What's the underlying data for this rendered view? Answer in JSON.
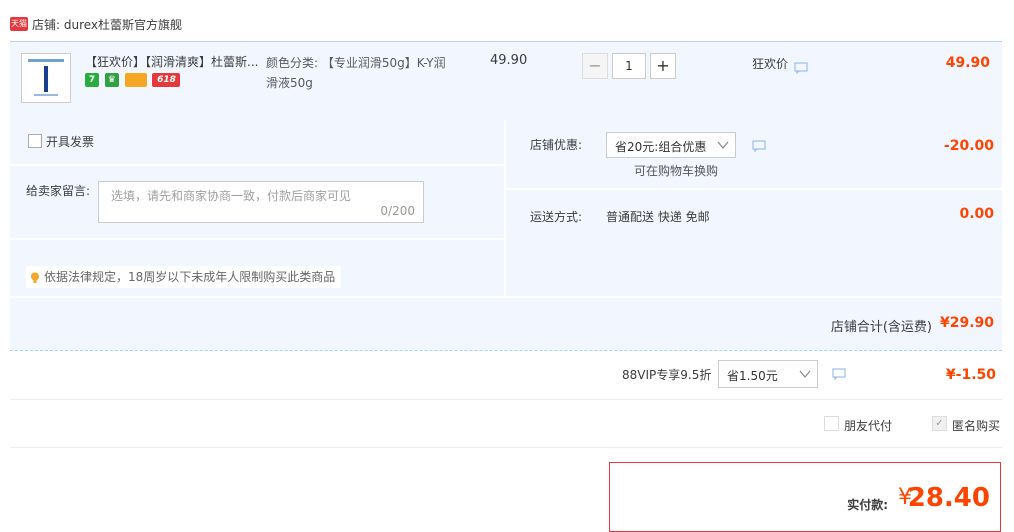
{
  "shop": {
    "badge": "天猫",
    "name": "店铺: durex杜蕾斯官方旗舰"
  },
  "item": {
    "title": "【狂欢价】【润滑清爽】杜蕾斯...",
    "tags": [
      "7",
      "♛",
      "",
      "618"
    ],
    "sku": "颜色分类: 【专业润滑50g】K-Y润滑液50g",
    "unit_price": "49.90",
    "qty_minus": "−",
    "qty": "1",
    "qty_plus": "+",
    "promo_label": "狂欢价",
    "sum": "49.90"
  },
  "options": {
    "invoice_label": "开具发票",
    "message_label": "给卖家留言:",
    "message_placeholder": "选填，请先和商家协商一致，付款后商家可见",
    "message_count": "0/200",
    "notice": "依据法律规定，18周岁以下未成年人限制购买此类商品"
  },
  "discount": {
    "label": "店铺优惠:",
    "selected": "省20元:组合优惠",
    "note": "可在购物车换购",
    "value": "-20.00"
  },
  "shipping": {
    "label": "运送方式:",
    "method": "普通配送 快递 免邮",
    "fee": "0.00"
  },
  "subtotal": {
    "label": "店铺合计(含运费)",
    "value": "¥29.90"
  },
  "vip": {
    "label": "88VIP专享9.5折",
    "selected": "省1.50元",
    "value": "¥-1.50"
  },
  "checks": {
    "friend_pay": "朋友代付",
    "anonymous": "匿名购买"
  },
  "total": {
    "label": "实付款:",
    "currency": "¥",
    "value": "28.40"
  },
  "colors": {
    "accent": "#ff4400",
    "row_bg": "#f2f7ff",
    "border": "#b2d1ff"
  }
}
